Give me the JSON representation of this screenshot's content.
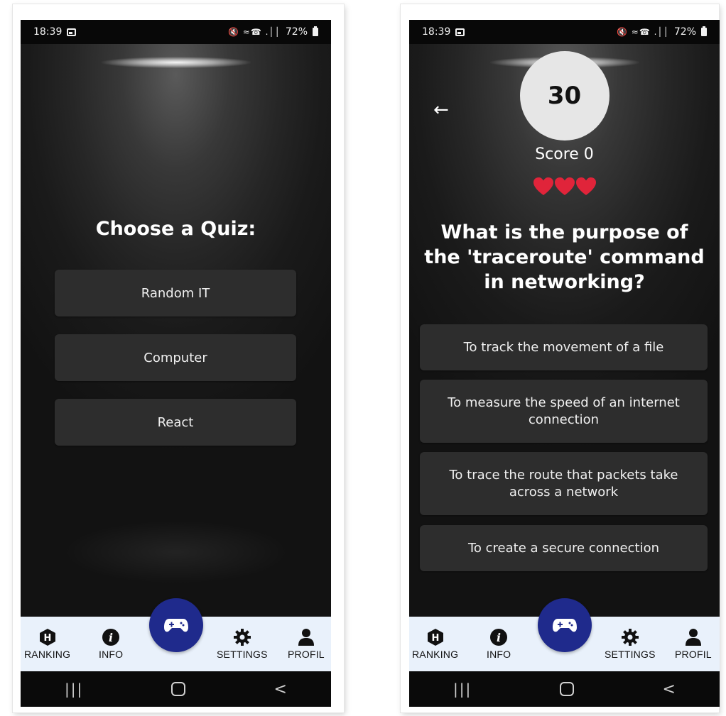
{
  "status_bar": {
    "time": "18:39",
    "signal": "🔇 ≈☎ .││",
    "battery": "72%"
  },
  "nav": {
    "ranking": "RANKING",
    "info": "INFO",
    "settings": "SETTINGS",
    "profil": "PROFIL"
  },
  "left_screen": {
    "title": "Choose a Quiz:",
    "options": [
      "Random IT",
      "Computer",
      "React"
    ]
  },
  "right_screen": {
    "timer": "30",
    "score": "Score 0",
    "lives": 3,
    "question": "What is the purpose of the 'traceroute' command in networking?",
    "answers": [
      "To track the movement of a file",
      "To measure the speed of an internet connection",
      "To trace the route that packets take across a network",
      "To create a secure connection"
    ]
  },
  "colors": {
    "fab": "#1f2a8c",
    "nav_bg": "#e9f1fb",
    "button_bg": "#2d2d2d",
    "heart": "#e0243a",
    "timer_bg": "#e6e6e6"
  }
}
